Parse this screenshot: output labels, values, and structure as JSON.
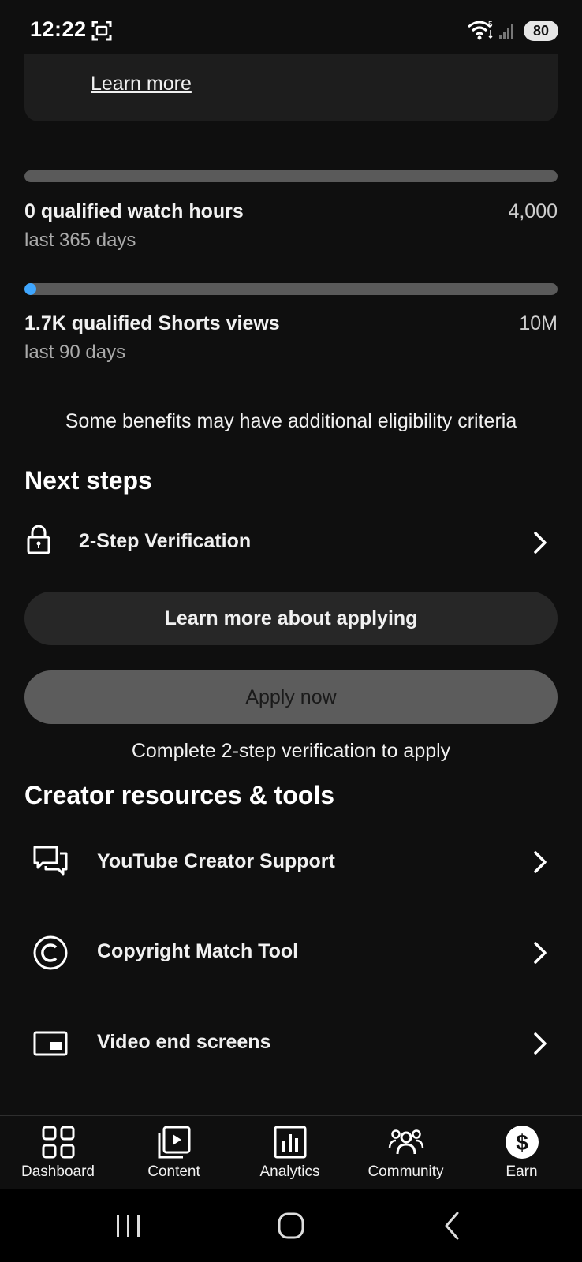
{
  "status_bar": {
    "time": "12:22",
    "battery": "80",
    "wifi_label": "5"
  },
  "top_card": {
    "learn_more": "Learn more"
  },
  "progress": [
    {
      "title": "0 qualified watch hours",
      "subtitle": "last 365 days",
      "goal": "4,000",
      "fraction": 0.0
    },
    {
      "title": "1.7K qualified Shorts views",
      "subtitle": "last 90 days",
      "goal": "10M",
      "fraction": 0.0017
    }
  ],
  "eligibility_note": "Some benefits may have additional eligibility criteria",
  "next_steps": {
    "heading": "Next steps",
    "items": [
      {
        "label": "2-Step Verification",
        "icon": "lock-icon"
      }
    ]
  },
  "buttons": {
    "learn_more_applying": "Learn more about applying",
    "apply_now": "Apply now",
    "apply_hint": "Complete 2-step verification to apply"
  },
  "creator_resources": {
    "heading": "Creator resources & tools",
    "items": [
      {
        "label": "YouTube Creator Support",
        "icon": "chat-bubbles-icon"
      },
      {
        "label": "Copyright Match Tool",
        "icon": "copyright-icon"
      },
      {
        "label": "Video end screens",
        "icon": "end-screen-icon"
      }
    ]
  },
  "bottom_nav": {
    "items": [
      {
        "label": "Dashboard",
        "icon": "dashboard-icon"
      },
      {
        "label": "Content",
        "icon": "content-icon"
      },
      {
        "label": "Analytics",
        "icon": "analytics-icon"
      },
      {
        "label": "Community",
        "icon": "community-icon"
      },
      {
        "label": "Earn",
        "icon": "earn-icon",
        "active": true
      }
    ]
  },
  "colors": {
    "background": "#0f0f0f",
    "accent": "#3ea6ff",
    "card": "#1d1d1d"
  }
}
